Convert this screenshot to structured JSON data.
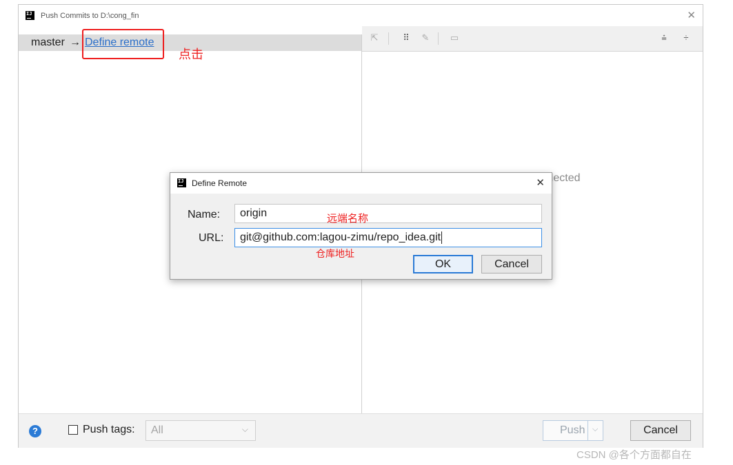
{
  "window": {
    "title": "Push Commits to D:\\cong_fin",
    "app_icon_text": "IJ"
  },
  "branch": {
    "name": "master",
    "arrow": "→",
    "link_label": "Define remote"
  },
  "annotations": {
    "click": "点击",
    "remote_name": "远端名称",
    "repo_url": "仓库地址",
    "color": "#ee2020"
  },
  "commits_panel": {
    "empty_text": "No commits selected"
  },
  "dialog": {
    "title": "Define Remote",
    "name_label": "Name:",
    "name_value": "origin",
    "url_label": "URL:",
    "url_value": "git@github.com:lagou-zimu/repo_idea.git",
    "ok_label": "OK",
    "cancel_label": "Cancel"
  },
  "bottom": {
    "help": "?",
    "push_tags_label": "Push tags:",
    "tags_value": "All",
    "push_label": "Push",
    "cancel_label": "Cancel"
  },
  "watermark": "CSDN @各个方面都自在",
  "colors": {
    "link": "#2a6ec9",
    "accent": "#2a7ad6",
    "annotation": "#ee2020"
  }
}
